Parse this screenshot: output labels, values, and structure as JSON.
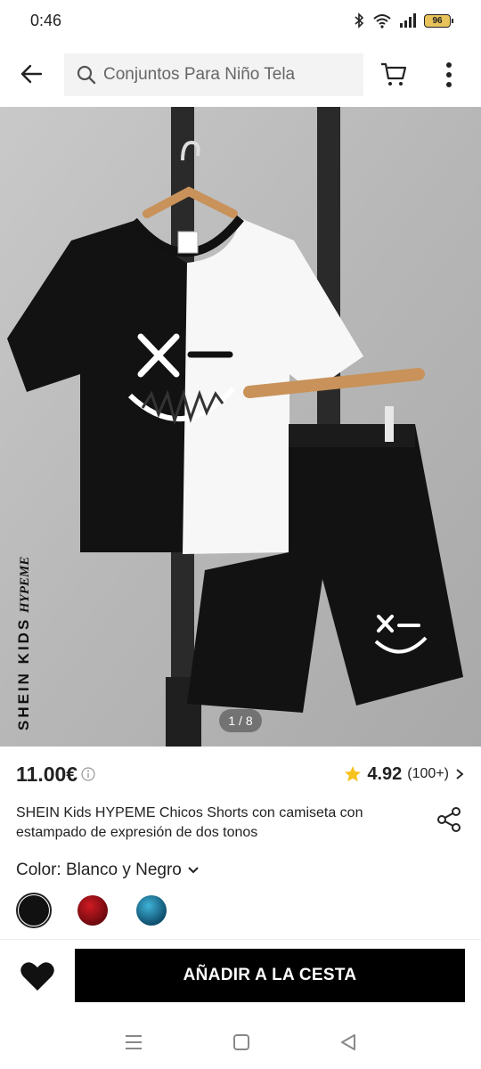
{
  "status_bar": {
    "time": "0:46",
    "battery": "96",
    "icons": [
      "bluetooth-icon",
      "wifi-icon",
      "signal-icon",
      "battery-icon"
    ]
  },
  "search": {
    "placeholder": "Conjuntos Para Niño Tela"
  },
  "gallery": {
    "counter": "1 / 8",
    "brand_text": "SHEIN KIDS",
    "brand_script": "HYPEME",
    "colors": {
      "background": "#bcbcbc",
      "black": "#111111",
      "white": "#f8f8f8",
      "pole": "#222222"
    }
  },
  "product": {
    "price": "11.00€",
    "rating": "4.92",
    "review_count": "(100+)",
    "title": "SHEIN Kids HYPEME Chicos Shorts con camiseta con estampado de expresión de dos tonos",
    "color_label": "Color: Blanco y Negro",
    "swatches": [
      {
        "name": "Blanco y Negro",
        "color": "#111111",
        "selected": true
      },
      {
        "name": "Rojo",
        "color": "#8b0d14",
        "selected": false
      },
      {
        "name": "Azul",
        "color": "#1f7fa8",
        "selected": false
      }
    ]
  },
  "actions": {
    "add_to_cart": "AÑADIR A LA CESTA"
  },
  "accent_colors": {
    "star": "#f6c21c",
    "button": "#000000"
  }
}
